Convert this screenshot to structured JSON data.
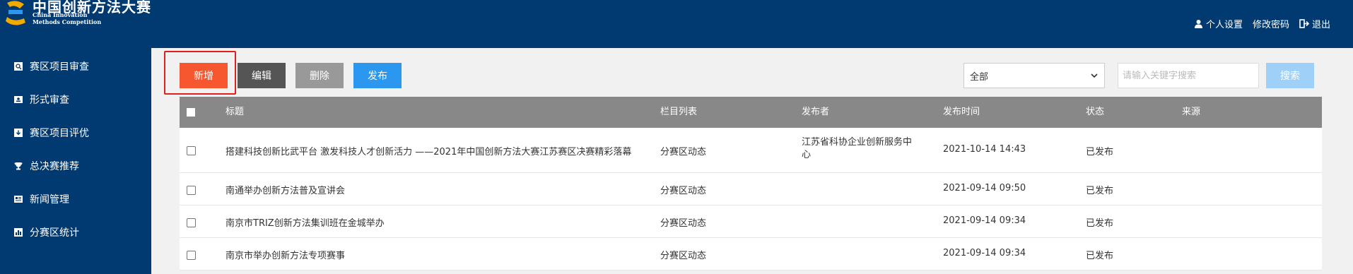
{
  "header": {
    "logo_cn": "中国创新方法大赛",
    "logo_en_line1": "China Innovation",
    "logo_en_line2": "Methods Competition",
    "links": {
      "profile": "个人设置",
      "password": "修改密码",
      "logout": "退出"
    }
  },
  "sidebar": {
    "items": [
      {
        "label": "赛区项目审查",
        "icon": "search-doc-icon"
      },
      {
        "label": "形式审查",
        "icon": "id-card-icon"
      },
      {
        "label": "赛区项目评优",
        "icon": "download-box-icon"
      },
      {
        "label": "总决赛推荐",
        "icon": "trophy-icon"
      },
      {
        "label": "新闻管理",
        "icon": "newspaper-icon"
      },
      {
        "label": "分赛区统计",
        "icon": "chart-icon"
      }
    ]
  },
  "toolbar": {
    "add_label": "新增",
    "edit_label": "编辑",
    "delete_label": "删除",
    "publish_label": "发布",
    "filter_value": "全部",
    "search_placeholder": "请输入关键字搜索",
    "search_label": "搜索"
  },
  "colors": {
    "header_bg": "#003a70",
    "add": "#f7572e",
    "edit": "#555555",
    "delete": "#999999",
    "publish": "#2c97ee",
    "search": "#9fd0f7",
    "table_header": "#888888",
    "highlight": "#e01f1f"
  },
  "table": {
    "headers": {
      "title": "标题",
      "column": "栏目列表",
      "publisher": "发布者",
      "time": "发布时间",
      "status": "状态",
      "source": "来源"
    },
    "rows": [
      {
        "title": "搭建科技创新比武平台 激发科技人才创新活力 ——2021年中国创新方法大赛江苏赛区决赛精彩落幕",
        "column": "分赛区动态",
        "publisher": "江苏省科协企业创新服务中心",
        "time": "2021-10-14 14:43",
        "status": "已发布",
        "source": ""
      },
      {
        "title": "南通举办创新方法普及宣讲会",
        "column": "分赛区动态",
        "publisher": "",
        "time": "2021-09-14 09:50",
        "status": "已发布",
        "source": ""
      },
      {
        "title": "南京市TRIZ创新方法集训班在金城举办",
        "column": "分赛区动态",
        "publisher": "",
        "time": "2021-09-14 09:34",
        "status": "已发布",
        "source": ""
      },
      {
        "title": "南京市举办创新方法专项赛事",
        "column": "分赛区动态",
        "publisher": "",
        "time": "2021-09-14 09:34",
        "status": "已发布",
        "source": ""
      }
    ]
  }
}
